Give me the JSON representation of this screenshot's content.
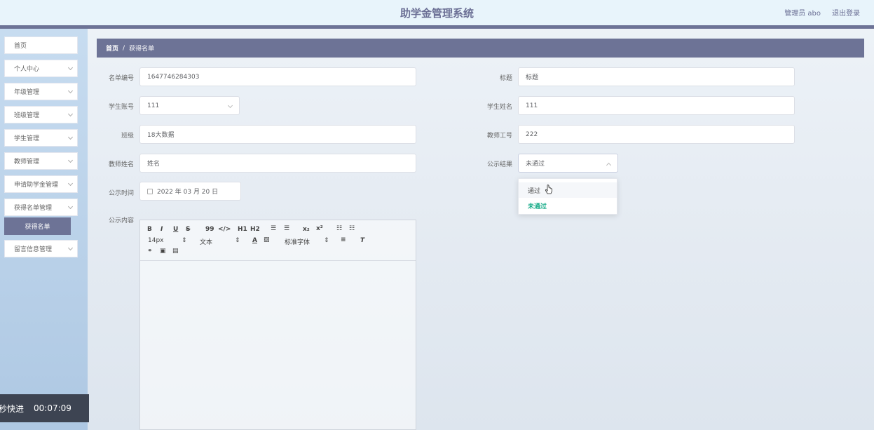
{
  "header": {
    "app_title": "助学金管理系统",
    "user_label": "管理员 abo",
    "logout_label": "退出登录"
  },
  "sidebar": {
    "items": [
      {
        "label": "首页"
      },
      {
        "label": "个人中心"
      },
      {
        "label": "年级管理"
      },
      {
        "label": "班级管理"
      },
      {
        "label": "学生管理"
      },
      {
        "label": "教师管理"
      },
      {
        "label": "申请助学金管理"
      },
      {
        "label": "获得名单管理"
      },
      {
        "label": "获得名单"
      },
      {
        "label": "留言信息管理"
      }
    ]
  },
  "breadcrumb": {
    "home": "首页",
    "separator": "/",
    "current": "获得名单"
  },
  "form": {
    "list_no_label": "名单编号",
    "list_no_value": "1647746284303",
    "title_label": "标题",
    "title_value": "标题",
    "student_account_label": "学生账号",
    "student_account_value": "111",
    "student_name_label": "学生姓名",
    "student_name_value": "111",
    "class_label": "班级",
    "class_value": "18大数据",
    "teacher_no_label": "教师工号",
    "teacher_no_value": "222",
    "teacher_name_label": "教师姓名",
    "teacher_name_value": "姓名",
    "result_label": "公示结果",
    "result_value": "未通过",
    "time_label": "公示时间",
    "time_value": "2022 年 03 月 20 日",
    "content_label": "公示内容"
  },
  "dropdown": {
    "options": [
      "通过",
      "未通过"
    ]
  },
  "editor": {
    "bold": "B",
    "italic": "I",
    "underline": "U",
    "strike": "S",
    "quote": "99",
    "code": "</>",
    "h1": "H1",
    "h2": "H2",
    "sub": "x₂",
    "sup": "x²",
    "size": "14px",
    "block": "文本",
    "font": "标准字体"
  },
  "video": {
    "label": "秒快进",
    "time": "00:07:09"
  }
}
